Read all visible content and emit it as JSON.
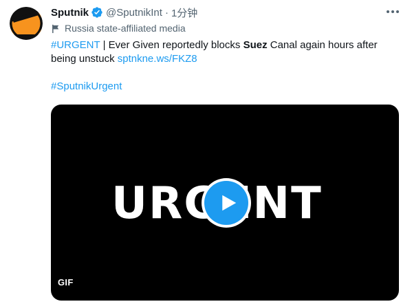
{
  "account": {
    "name": "Sputnik",
    "handle": "@SputnikInt",
    "separator": "·",
    "time": "1分钟",
    "affiliation": "Russia state-affiliated media",
    "verified": true,
    "avatar_icon": "sputnik-logo",
    "brand_color": "#f7931e"
  },
  "tweet": {
    "hashtag_urgent": "#URGENT",
    "text_part1": " | Ever Given reportedly blocks ",
    "text_bold": "Suez",
    "text_part2": " Canal again hours after being unstuck ",
    "link": "sptnkne.ws/FKZ8",
    "hashtag_tag": "#SputnikUrgent"
  },
  "media": {
    "overlay_text": "URGENT",
    "badge": "GIF",
    "play_icon": "play-icon",
    "play_color": "#1d9bf0"
  },
  "colors": {
    "link": "#1d9bf0",
    "secondary_text": "#536471",
    "primary_text": "#0f1419"
  }
}
